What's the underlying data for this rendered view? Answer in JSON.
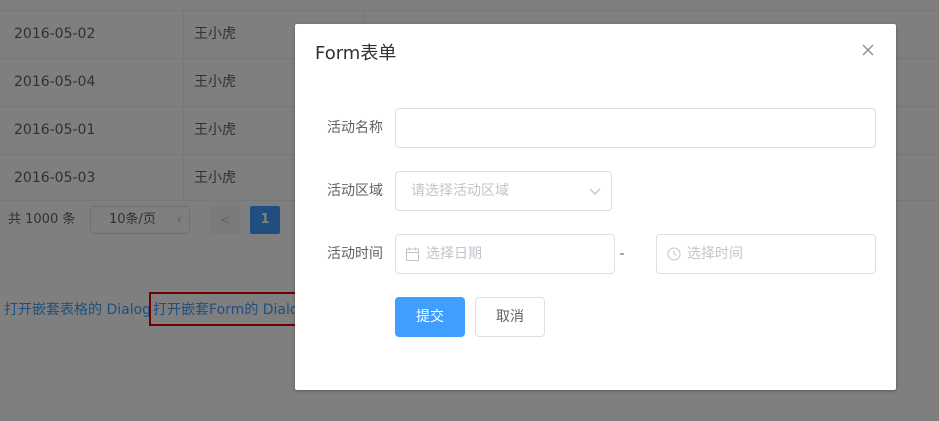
{
  "table": {
    "rows": [
      {
        "date": "2016-05-02",
        "name": "王小虎"
      },
      {
        "date": "2016-05-04",
        "name": "王小虎"
      },
      {
        "date": "2016-05-01",
        "name": "王小虎"
      },
      {
        "date": "2016-05-03",
        "name": "王小虎"
      }
    ]
  },
  "pagination": {
    "total_label": "共 1000 条",
    "page_size_label": "10条/页",
    "current_page": "1"
  },
  "links": {
    "table_dialog": "打开嵌套表格的 Dialog",
    "form_dialog": "打开嵌套Form的 Dialog"
  },
  "dialog": {
    "title": "Form表单",
    "fields": {
      "name_label": "活动名称",
      "name_value": "",
      "region_label": "活动区域",
      "region_placeholder": "请选择活动区域",
      "time_label": "活动时间",
      "date_placeholder": "选择日期",
      "separator": "-",
      "time_placeholder": "选择时间"
    },
    "buttons": {
      "submit": "提交",
      "cancel": "取消"
    }
  },
  "colors": {
    "primary": "#409eff",
    "highlight_border": "#e00000",
    "overlay": "rgba(0,0,0,0.5)"
  }
}
